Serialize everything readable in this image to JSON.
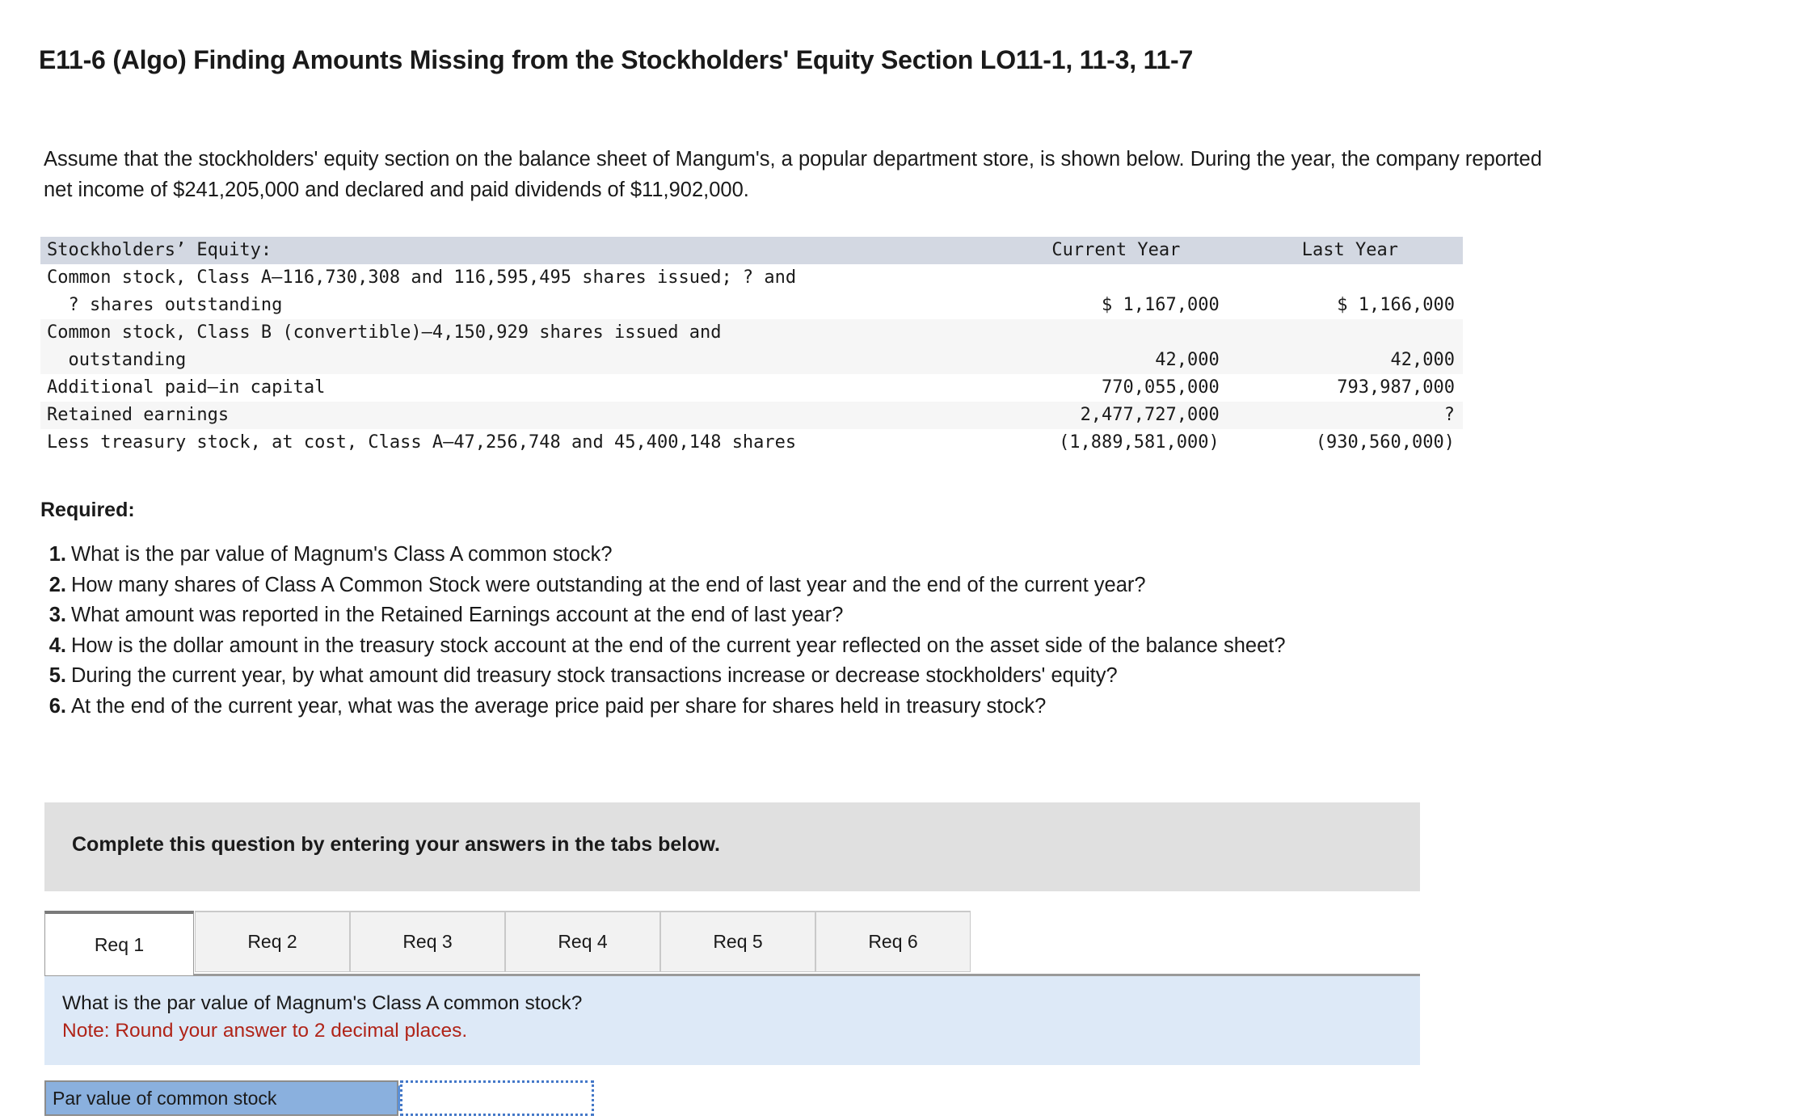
{
  "page_title": "E11-6 (Algo) Finding Amounts Missing from the Stockholders' Equity Section LO11-1, 11-3, 11-7",
  "intro": "Assume that the stockholders' equity section on the balance sheet of Mangum's, a popular department store, is shown below. During the year, the company reported net income of $241,205,000 and declared and paid dividends of $11,902,000.",
  "table": {
    "header": {
      "label": "Stockholders’ Equity:",
      "current_year": "Current Year",
      "last_year": "Last Year"
    },
    "rows": [
      {
        "label_line1": "Common stock, Class A—116,730,308 and 116,595,495 shares issued; ? and",
        "label_line2": "  ? shares outstanding",
        "current_year": "$ 1,167,000",
        "last_year": "$ 1,166,000",
        "shaded": false
      },
      {
        "label_line1": "Common stock, Class B (convertible)—4,150,929 shares issued and",
        "label_line2": "  outstanding",
        "current_year": "42,000",
        "last_year": "42,000",
        "shaded": true
      },
      {
        "label_line1": "Additional paid—in capital",
        "label_line2": "",
        "current_year": "770,055,000",
        "last_year": "793,987,000",
        "shaded": false
      },
      {
        "label_line1": "Retained earnings",
        "label_line2": "",
        "current_year": "2,477,727,000",
        "last_year": "?",
        "shaded": true
      },
      {
        "label_line1": "Less treasury stock, at cost, Class A—47,256,748 and 45,400,148 shares",
        "label_line2": "",
        "current_year": "(1,889,581,000)",
        "last_year": "(930,560,000)",
        "shaded": false
      }
    ]
  },
  "required": {
    "heading": "Required:",
    "items": [
      {
        "num": "1.",
        "text": "What is the par value of Magnum's Class A common stock?"
      },
      {
        "num": "2.",
        "text": "How many shares of Class A Common Stock were outstanding at the end of last year and the end of the current year?"
      },
      {
        "num": "3.",
        "text": "What amount was reported in the Retained Earnings account at the end of last year?"
      },
      {
        "num": "4.",
        "text": "How is the dollar amount in the treasury stock account at the end of the current year reflected on the asset side of the balance sheet?"
      },
      {
        "num": "5.",
        "text": "During the current year, by what amount did treasury stock transactions increase or decrease stockholders' equity?"
      },
      {
        "num": "6.",
        "text": "At the end of the current year, what was the average price paid per share for shares held in treasury stock?"
      }
    ]
  },
  "instruction_banner": "Complete this question by entering your answers in the tabs below.",
  "tabs": [
    {
      "label": "Req 1",
      "active": true
    },
    {
      "label": "Req 2",
      "active": false
    },
    {
      "label": "Req 3",
      "active": false
    },
    {
      "label": "Req 4",
      "active": false
    },
    {
      "label": "Req 5",
      "active": false
    },
    {
      "label": "Req 6",
      "active": false
    }
  ],
  "question_panel": {
    "question": "What is the par value of Magnum's Class A common stock?",
    "note": "Note: Round your answer to 2 decimal places."
  },
  "answer_row": {
    "label": "Par value of common stock",
    "value": "",
    "placeholder": ""
  },
  "colors": {
    "table_header_band": "#d3d8e2",
    "table_row_shaded": "#f6f6f6",
    "instruction_banner": "#e0e0e0",
    "question_panel": "#dde9f7",
    "note_text": "#b02418",
    "answer_label": "#8ab0de",
    "input_focus_border": "#4478c8"
  }
}
